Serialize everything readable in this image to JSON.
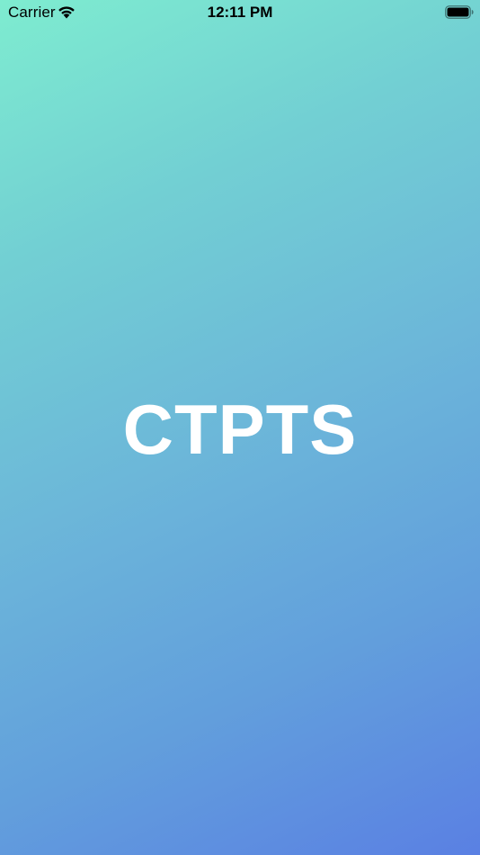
{
  "status_bar": {
    "carrier": "Carrier",
    "time": "12:11 PM",
    "wifi_icon": "wifi-icon",
    "battery_icon": "battery-full-icon"
  },
  "splash": {
    "title": "CTPTS"
  },
  "colors": {
    "gradient_start": "#7eecd0",
    "gradient_end": "#5a80e3",
    "title_color": "#ffffff"
  }
}
